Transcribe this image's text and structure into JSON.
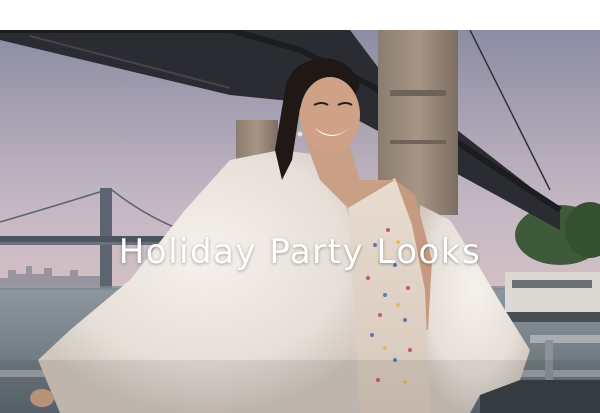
{
  "hero": {
    "headline": "Holiday Party Looks"
  },
  "icons": {
    "hero_image": "holiday-party-photo"
  },
  "colors": {
    "headline_text": "#ffffff",
    "page_background": "#ffffff"
  }
}
